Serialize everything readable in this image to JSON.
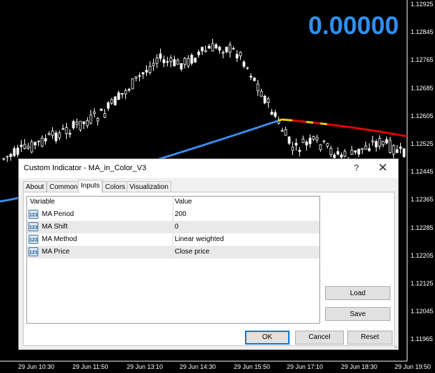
{
  "chart": {
    "big_value": "0.00000",
    "price_ticks": [
      "1.12925",
      "1.12845",
      "1.12765",
      "1.12685",
      "1.12605",
      "1.12525",
      "1.12445",
      "1.12365",
      "1.12285",
      "1.12205",
      "1.12125",
      "1.12045",
      "1.11965"
    ],
    "time_ticks": [
      "29 Jun 10:30",
      "29 Jun 11:50",
      "29 Jun 13:10",
      "29 Jun 14:30",
      "29 Jun 15:50",
      "29 Jun 17:10",
      "29 Jun 18:30",
      "29 Jun 19:50"
    ],
    "colors": {
      "ma_rising": "#3a8ff0",
      "ma_falling": "#e60000",
      "ma_flat": "#f0d000",
      "value_text": "#2f8ff0"
    }
  },
  "dialog": {
    "title": "Custom Indicator - MA_in_Color_V3",
    "help_label": "?",
    "close_label": "✕",
    "tabs": [
      {
        "label": "About"
      },
      {
        "label": "Common"
      },
      {
        "label": "Inputs",
        "active": true
      },
      {
        "label": "Colors"
      },
      {
        "label": "Visualization"
      }
    ],
    "table": {
      "headers": {
        "variable": "Variable",
        "value": "Value"
      },
      "rows": [
        {
          "name": "MA Period",
          "value": "200",
          "icon": "number-123-icon"
        },
        {
          "name": "MA Shift",
          "value": "0",
          "icon": "number-123-icon"
        },
        {
          "name": "MA Method",
          "value": "Linear weighted",
          "icon": "number-123-icon"
        },
        {
          "name": "MA Price",
          "value": "Close price",
          "icon": "number-123-icon"
        }
      ]
    },
    "buttons": {
      "load": "Load",
      "save": "Save",
      "ok": "OK",
      "cancel": "Cancel",
      "reset": "Reset"
    }
  }
}
